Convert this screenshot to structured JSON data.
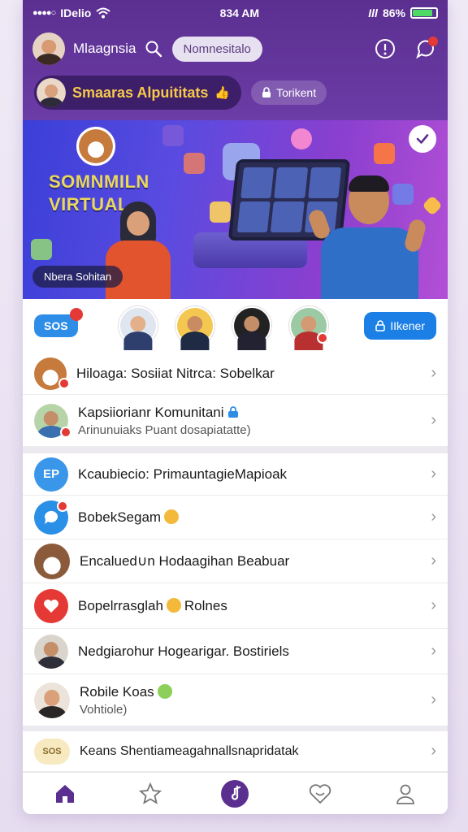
{
  "status_bar": {
    "carrier": "IDelio",
    "time": "834 AM",
    "signal_text": "Ill",
    "battery_percent": "86%",
    "battery_level": 0.86
  },
  "header": {
    "user_name": "Mlaagnsia",
    "search_pill": "Nomnesitalo",
    "community_name": "Smaaras Alpuititats",
    "ticket_label": "Torikent"
  },
  "banner": {
    "title_line1": "SOMNMILN",
    "title_line2": "VIRTUAL",
    "caption": "Nbera Sohitan"
  },
  "stories": {
    "chip_label": "SOS",
    "follow_label": "IIkener"
  },
  "list_top": [
    {
      "title": "Hiloaga: Sosiiat Nitrca: Sobelkar",
      "subtitle": "",
      "icon": "dog-icon"
    },
    {
      "title": "Kapsiiorianr Komunitani",
      "subtitle": "Arinunuiaks Puant dosapiatatte)",
      "icon": "person-icon"
    }
  ],
  "list_bottom": [
    {
      "title": "Kcaubiecio: PrimauntagieMapioak",
      "subtitle": "",
      "icon": "ep-icon",
      "color": "#3a96e8"
    },
    {
      "title": "BobekSegam",
      "subtitle": "",
      "icon": "chat-icon",
      "color": "#2a8fe6"
    },
    {
      "title": "Encalued∪n Hodaagihan Beabuar",
      "subtitle": "",
      "icon": "dog-icon",
      "color": "#8b5a3a"
    },
    {
      "title": "Bopelrrasglah",
      "suffix": "Rolnes",
      "subtitle": "",
      "icon": "heart-icon",
      "color": "#e53935"
    },
    {
      "title": "Nedgiarohur Hogearigar. Bostiriels",
      "subtitle": "",
      "icon": "person-icon",
      "color": "#777"
    },
    {
      "title": "Robile Koas",
      "subtitle": "Vohtiole)",
      "icon": "person-icon",
      "color": "#555"
    },
    {
      "title": "Keans Shentiameagahnallsnapridatak",
      "subtitle": "",
      "icon": "sos-icon",
      "color": "#f7e9c0"
    }
  ],
  "colors": {
    "header_purple": "#5b2f90",
    "community_gold": "#f5c94a",
    "accent_blue": "#1b7fe6",
    "tab_active": "#5b2f90"
  }
}
